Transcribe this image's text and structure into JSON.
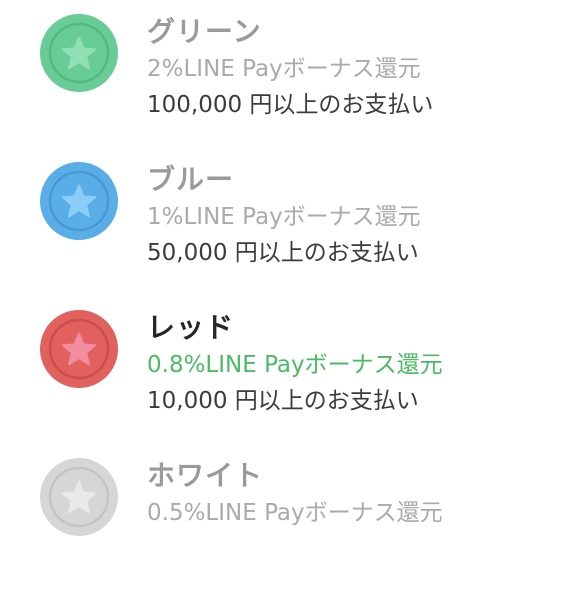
{
  "tiers": [
    {
      "name": "グリーン",
      "bonus": "2%LINE Payボーナス還元",
      "requirement": "100,000 円以上のお支払い",
      "is_current": false,
      "icon": "star-medal-icon",
      "coin_color": "#67cc96",
      "coin_ring": "#55b882",
      "star_color": "#8fe0b4"
    },
    {
      "name": "ブルー",
      "bonus": "1%LINE Payボーナス還元",
      "requirement": "50,000 円以上のお支払い",
      "is_current": false,
      "icon": "star-medal-icon",
      "coin_color": "#5aaee8",
      "coin_ring": "#4898d4",
      "star_color": "#8ccdf8"
    },
    {
      "name": "レッド",
      "bonus": "0.8%LINE Payボーナス還元",
      "requirement": "10,000 円以上のお支払い",
      "is_current": true,
      "icon": "star-medal-icon",
      "coin_color": "#e0615e",
      "coin_ring": "#c94e4c",
      "star_color": "#f28da0"
    },
    {
      "name": "ホワイト",
      "bonus": "0.5%LINE Payボーナス還元",
      "requirement": "",
      "is_current": false,
      "icon": "star-medal-icon",
      "coin_color": "#d6d6d6",
      "coin_ring": "#c4c4c4",
      "star_color": "#e9e9e9"
    }
  ],
  "colors": {
    "inactive_name": "#9a9a9a",
    "inactive_bonus": "#aaaaaa",
    "active_name": "#262626",
    "active_bonus": "#4cba64",
    "requirement": "#3c3c3c"
  }
}
